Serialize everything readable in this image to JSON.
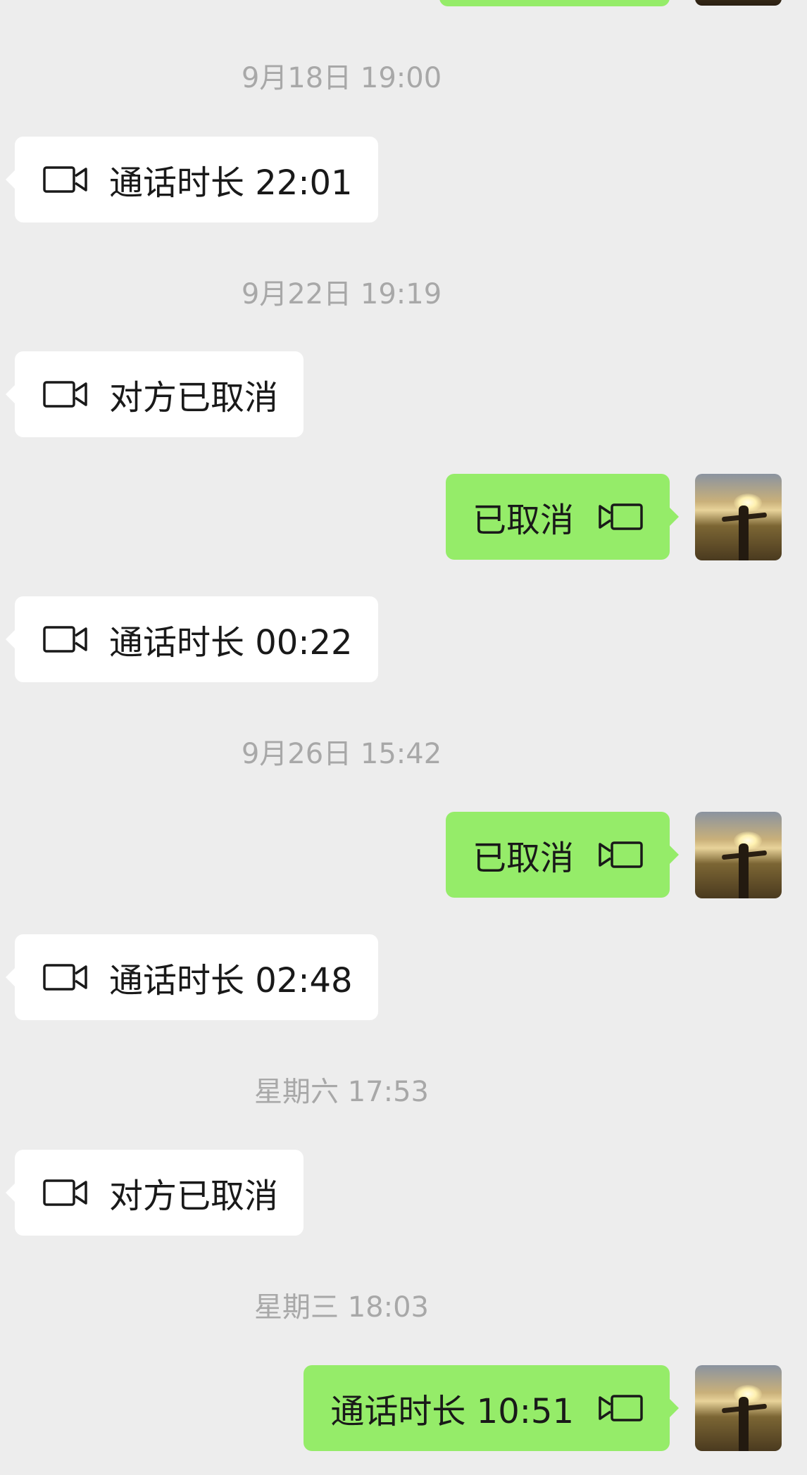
{
  "messages": [
    {
      "type": "timestamp",
      "text": "9月18日 19:00"
    },
    {
      "type": "call",
      "direction": "incoming",
      "text": "通话时长 22:01",
      "icon": "video-call-icon"
    },
    {
      "type": "timestamp",
      "text": "9月22日 19:19"
    },
    {
      "type": "call",
      "direction": "incoming",
      "text": "对方已取消",
      "icon": "video-call-icon"
    },
    {
      "type": "call",
      "direction": "outgoing",
      "text": "已取消",
      "icon": "video-call-icon"
    },
    {
      "type": "call",
      "direction": "incoming",
      "text": "通话时长 00:22",
      "icon": "video-call-icon"
    },
    {
      "type": "timestamp",
      "text": "9月26日 15:42"
    },
    {
      "type": "call",
      "direction": "outgoing",
      "text": "已取消",
      "icon": "video-call-icon"
    },
    {
      "type": "call",
      "direction": "incoming",
      "text": "通话时长 02:48",
      "icon": "video-call-icon"
    },
    {
      "type": "timestamp",
      "text": "星期六 17:53"
    },
    {
      "type": "call",
      "direction": "incoming",
      "text": "对方已取消",
      "icon": "video-call-icon"
    },
    {
      "type": "timestamp",
      "text": "星期三 18:03"
    },
    {
      "type": "call",
      "direction": "outgoing",
      "text": "通话时长 10:51",
      "icon": "video-call-icon"
    }
  ],
  "colors": {
    "background": "#ededed",
    "incoming_bubble": "#ffffff",
    "outgoing_bubble": "#95ec69",
    "timestamp_text": "#a8a8a8",
    "message_text": "#191919"
  }
}
